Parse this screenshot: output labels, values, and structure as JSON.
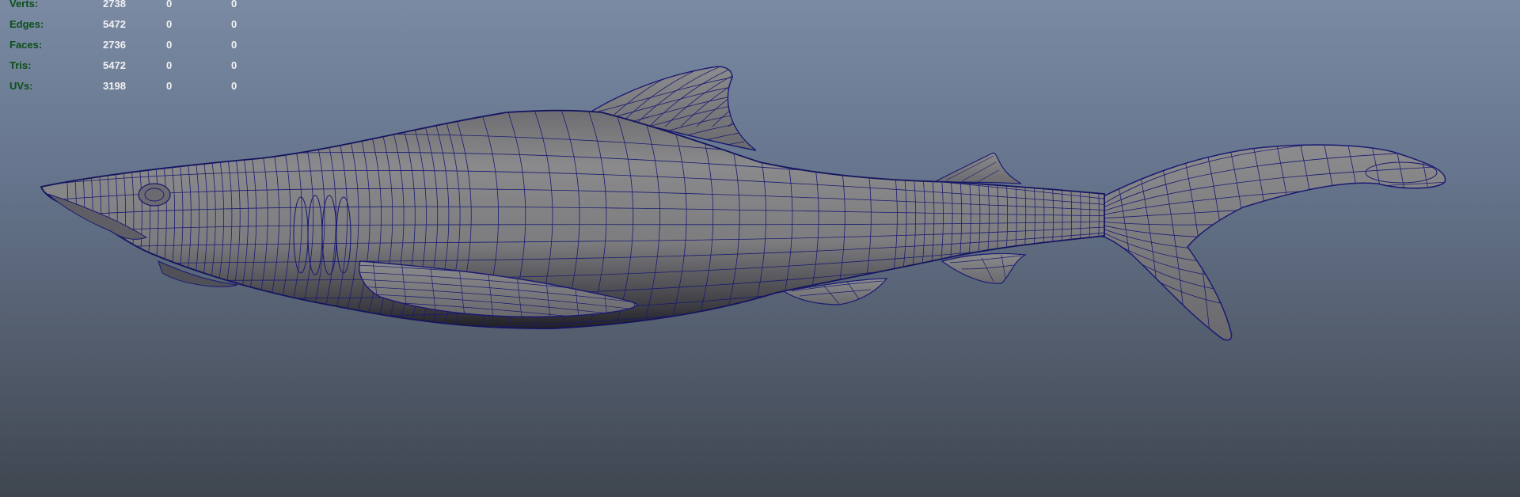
{
  "viewport": {
    "type": "3d-viewport",
    "background_top": "#7a8aa3",
    "background_bottom": "#3f4650",
    "mesh_color": "#7e7e80",
    "wire_color": "#1a1a72"
  },
  "heads_up_display": {
    "rows": [
      {
        "label": "Verts:",
        "c1": "2738",
        "c2": "0",
        "c3": "0"
      },
      {
        "label": "Edges:",
        "c1": "5472",
        "c2": "0",
        "c3": "0"
      },
      {
        "label": "Faces:",
        "c1": "2736",
        "c2": "0",
        "c3": "0"
      },
      {
        "label": "Tris:",
        "c1": "5472",
        "c2": "0",
        "c3": "0"
      },
      {
        "label": "UVs:",
        "c1": "3198",
        "c2": "0",
        "c3": "0"
      }
    ]
  },
  "model": {
    "icon": "shark-wireframe-mesh"
  }
}
